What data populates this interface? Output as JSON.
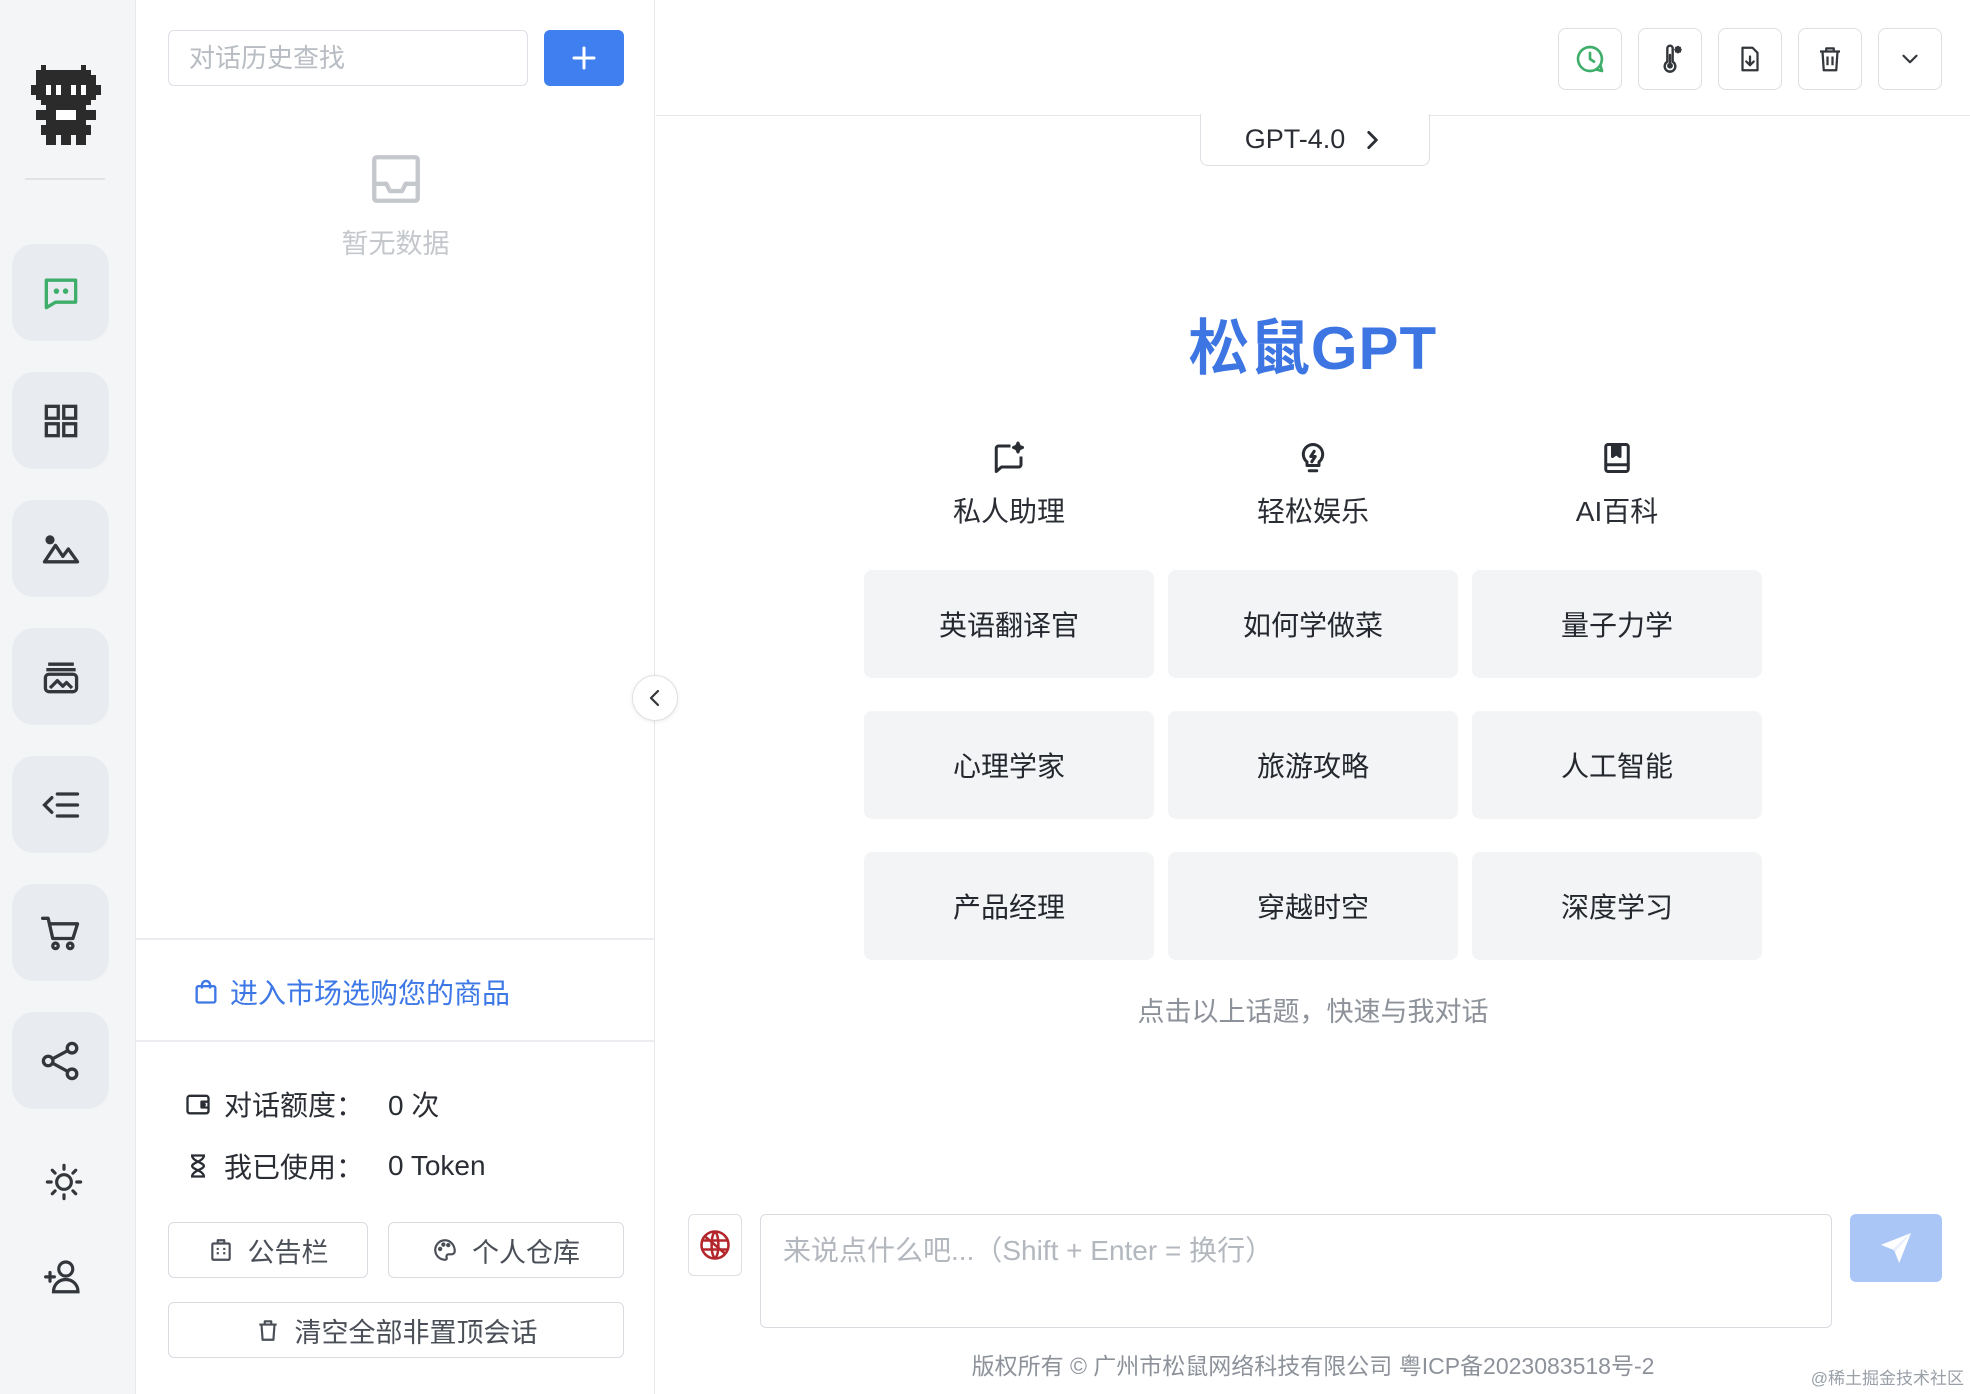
{
  "sidebar": {
    "nav_icons": [
      "chat-icon",
      "apps-grid-icon",
      "image-icon",
      "gallery-icon",
      "outline-icon",
      "cart-icon",
      "share-icon"
    ],
    "bottom_icons": [
      "sun-icon",
      "add-user-icon"
    ]
  },
  "history": {
    "search_placeholder": "对话历史查找",
    "empty_text": "暂无数据",
    "market_link": "进入市场选购您的商品",
    "quota_label": "对话额度：",
    "quota_value": "0 次",
    "used_label": "我已使用：",
    "used_value": "0 Token",
    "notice_button": "公告栏",
    "warehouse_button": "个人仓库",
    "clear_button": "清空全部非置顶会话"
  },
  "main": {
    "toolbar_icons": [
      "chat-history-icon",
      "temperature-icon",
      "export-icon",
      "delete-icon",
      "chevron-down-icon"
    ],
    "model": "GPT-4.0",
    "brand": "松鼠GPT",
    "categories": [
      {
        "label": "私人助理",
        "icon": "assistant-icon"
      },
      {
        "label": "轻松娱乐",
        "icon": "lightbulb-icon"
      },
      {
        "label": "AI百科",
        "icon": "book-icon"
      }
    ],
    "topics": [
      [
        "英语翻译官",
        "如何学做菜",
        "量子力学"
      ],
      [
        "心理学家",
        "旅游攻略",
        "人工智能"
      ],
      [
        "产品经理",
        "穿越时空",
        "深度学习"
      ]
    ],
    "hint": "点击以上话题，快速与我对话",
    "input_placeholder": "来说点什么吧...（Shift + Enter = 换行）",
    "footer": "版权所有 © 广州市松鼠网络科技有限公司   粤ICP备2023083518号-2",
    "watermark": "@稀土掘金技术社区"
  },
  "colors": {
    "accent": "#3f7ff0",
    "brand_text": "#3d76e3",
    "send_disabled": "#a9c6f7",
    "chat_icon": "#3fae6a"
  }
}
